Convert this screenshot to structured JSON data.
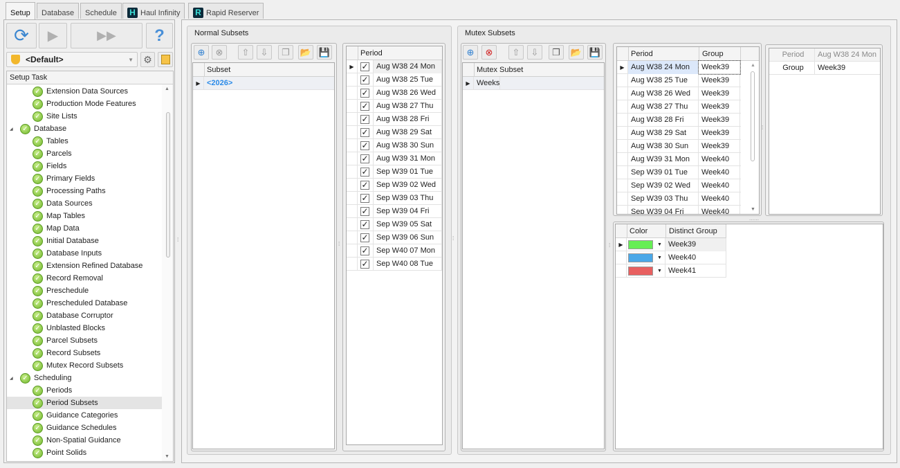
{
  "tabs": [
    {
      "label": "Setup"
    },
    {
      "label": "Database"
    },
    {
      "label": "Schedule"
    },
    {
      "label": "Haul Infinity"
    },
    {
      "label": "Rapid Reserver"
    }
  ],
  "left": {
    "profile": "<Default>",
    "tree_header": "Setup Task",
    "tree": [
      {
        "label": "Extension Data Sources",
        "level": 1
      },
      {
        "label": "Production Mode Features",
        "level": 1
      },
      {
        "label": "Site Lists",
        "level": 1
      },
      {
        "label": "Database",
        "level": 0,
        "expanded": true
      },
      {
        "label": "Tables",
        "level": 1
      },
      {
        "label": "Parcels",
        "level": 1
      },
      {
        "label": "Fields",
        "level": 1
      },
      {
        "label": "Primary Fields",
        "level": 1
      },
      {
        "label": "Processing Paths",
        "level": 1
      },
      {
        "label": "Data Sources",
        "level": 1
      },
      {
        "label": "Map Tables",
        "level": 1
      },
      {
        "label": "Map Data",
        "level": 1
      },
      {
        "label": "Initial Database",
        "level": 1
      },
      {
        "label": "Database Inputs",
        "level": 1
      },
      {
        "label": "Extension Refined Database",
        "level": 1
      },
      {
        "label": "Record Removal",
        "level": 1
      },
      {
        "label": "Preschedule",
        "level": 1
      },
      {
        "label": "Prescheduled Database",
        "level": 1
      },
      {
        "label": "Database Corruptor",
        "level": 1
      },
      {
        "label": "Unblasted Blocks",
        "level": 1
      },
      {
        "label": "Parcel Subsets",
        "level": 1
      },
      {
        "label": "Record Subsets",
        "level": 1
      },
      {
        "label": "Mutex Record Subsets",
        "level": 1
      },
      {
        "label": "Scheduling",
        "level": 0,
        "expanded": true
      },
      {
        "label": "Periods",
        "level": 1
      },
      {
        "label": "Period Subsets",
        "level": 1,
        "selected": true
      },
      {
        "label": "Guidance Categories",
        "level": 1
      },
      {
        "label": "Guidance Schedules",
        "level": 1
      },
      {
        "label": "Non-Spatial Guidance",
        "level": 1
      },
      {
        "label": "Point Solids",
        "level": 1
      }
    ]
  },
  "normal": {
    "title": "Normal Subsets",
    "subset_header": "Subset",
    "subsets": [
      "<2026>"
    ],
    "period_header": "Period",
    "periods": [
      "Aug W38 24 Mon",
      "Aug W38 25 Tue",
      "Aug W38 26 Wed",
      "Aug W38 27 Thu",
      "Aug W38 28 Fri",
      "Aug W38 29 Sat",
      "Aug W38 30 Sun",
      "Aug W39 31 Mon",
      "Sep W39 01 Tue",
      "Sep W39 02 Wed",
      "Sep W39 03 Thu",
      "Sep W39 04 Fri",
      "Sep W39 05 Sat",
      "Sep W39 06 Sun",
      "Sep W40 07 Mon",
      "Sep W40 08 Tue"
    ]
  },
  "mutex": {
    "title": "Mutex Subsets",
    "subset_header": "Mutex Subset",
    "subsets": [
      "Weeks"
    ],
    "period_header": "Period",
    "group_header": "Group",
    "rows": [
      [
        "Aug W38 24 Mon",
        "Week39"
      ],
      [
        "Aug W38 25 Tue",
        "Week39"
      ],
      [
        "Aug W38 26 Wed",
        "Week39"
      ],
      [
        "Aug W38 27 Thu",
        "Week39"
      ],
      [
        "Aug W38 28 Fri",
        "Week39"
      ],
      [
        "Aug W38 29 Sat",
        "Week39"
      ],
      [
        "Aug W38 30 Sun",
        "Week39"
      ],
      [
        "Aug W39 31 Mon",
        "Week40"
      ],
      [
        "Sep W39 01 Tue",
        "Week40"
      ],
      [
        "Sep W39 02 Wed",
        "Week40"
      ],
      [
        "Sep W39 03 Thu",
        "Week40"
      ],
      [
        "Sep W39 04 Fri",
        "Week40"
      ]
    ],
    "props": [
      {
        "label": "Period",
        "value": "Aug W38 24 Mon"
      },
      {
        "label": "Group",
        "value": "Week39"
      }
    ],
    "color_header": "Color",
    "distinct_header": "Distinct Group",
    "groups": [
      {
        "name": "Week39",
        "color": "#66ee55"
      },
      {
        "name": "Week40",
        "color": "#4aa8e8"
      },
      {
        "name": "Week41",
        "color": "#e86060"
      }
    ]
  }
}
